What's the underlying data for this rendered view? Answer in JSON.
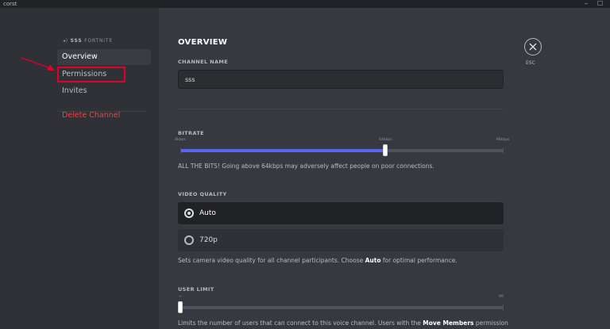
{
  "window": {
    "app_name": "corst",
    "minimize_glyph": "–",
    "maximize_glyph": "☐"
  },
  "sidebar": {
    "guild_prefix": "SSS",
    "guild_name": "FORTNITE",
    "items": [
      {
        "label": "Overview"
      },
      {
        "label": "Permissions"
      },
      {
        "label": "Invites"
      }
    ],
    "delete_label": "Delete Channel"
  },
  "main": {
    "section_title": "OVERVIEW",
    "channel_name_label": "CHANNEL NAME",
    "channel_name_value": "sss",
    "bitrate": {
      "label": "BITRATE",
      "min_label": "8kbps",
      "mid_label": "64kbps",
      "max_label": "96kbps",
      "min": 8,
      "max": 96,
      "value": 64,
      "help": "ALL THE BITS! Going above 64kbps may adversely affect people on poor connections."
    },
    "video_quality": {
      "label": "VIDEO QUALITY",
      "options": [
        {
          "label": "Auto"
        },
        {
          "label": "720p"
        }
      ],
      "help_before": "Sets camera video quality for all channel participants. Choose ",
      "help_bold": "Auto",
      "help_after": " for optimal performance."
    },
    "user_limit": {
      "label": "USER LIMIT",
      "min_label": "∞",
      "max_label": "99",
      "min": 0,
      "max": 99,
      "value": 0,
      "help_before": "Limits the number of users that can connect to this voice channel. Users with the ",
      "help_bold": "Move Members",
      "help_after": " permission"
    },
    "close_label": "ESC"
  },
  "colors": {
    "accent": "#5865f2",
    "danger": "#ed4245",
    "highlight": "#e0002a"
  }
}
